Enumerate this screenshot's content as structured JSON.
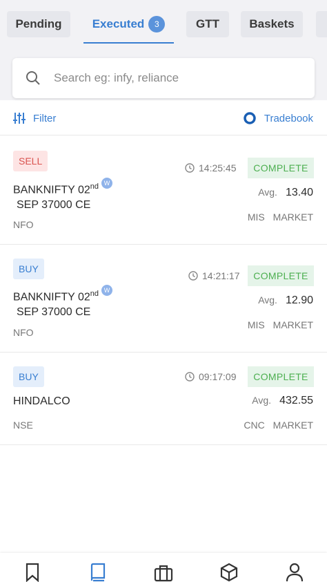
{
  "tabs": [
    {
      "label": "Pending"
    },
    {
      "label": "Executed",
      "count": "3"
    },
    {
      "label": "GTT"
    },
    {
      "label": "Baskets"
    }
  ],
  "search": {
    "placeholder": "Search eg: infy, reliance"
  },
  "toolbar": {
    "filter_label": "Filter",
    "tradebook_label": "Tradebook"
  },
  "orders": [
    {
      "side": "SELL",
      "time": "14:25:45",
      "status": "COMPLETE",
      "symbol_line1": "BANKNIFTY 02",
      "symbol_sup": "nd",
      "symbol_line2": "SEP 37000 CE",
      "weekly_badge": "W",
      "avg_label": "Avg.",
      "avg_price": "13.40",
      "exchange": "NFO",
      "product": "MIS",
      "order_type": "MARKET"
    },
    {
      "side": "BUY",
      "time": "14:21:17",
      "status": "COMPLETE",
      "symbol_line1": "BANKNIFTY 02",
      "symbol_sup": "nd",
      "symbol_line2": "SEP 37000 CE",
      "weekly_badge": "W",
      "avg_label": "Avg.",
      "avg_price": "12.90",
      "exchange": "NFO",
      "product": "MIS",
      "order_type": "MARKET"
    },
    {
      "side": "BUY",
      "time": "09:17:09",
      "status": "COMPLETE",
      "symbol_line1": "HINDALCO",
      "avg_label": "Avg.",
      "avg_price": "432.55",
      "exchange": "NSE",
      "product": "CNC",
      "order_type": "MARKET"
    }
  ],
  "bottom_nav": [
    "bookmark-icon",
    "orders-icon",
    "portfolio-icon",
    "positions-icon",
    "account-icon"
  ],
  "colors": {
    "accent": "#387ed1",
    "sell": "#d9534f",
    "complete": "#4caf50"
  }
}
